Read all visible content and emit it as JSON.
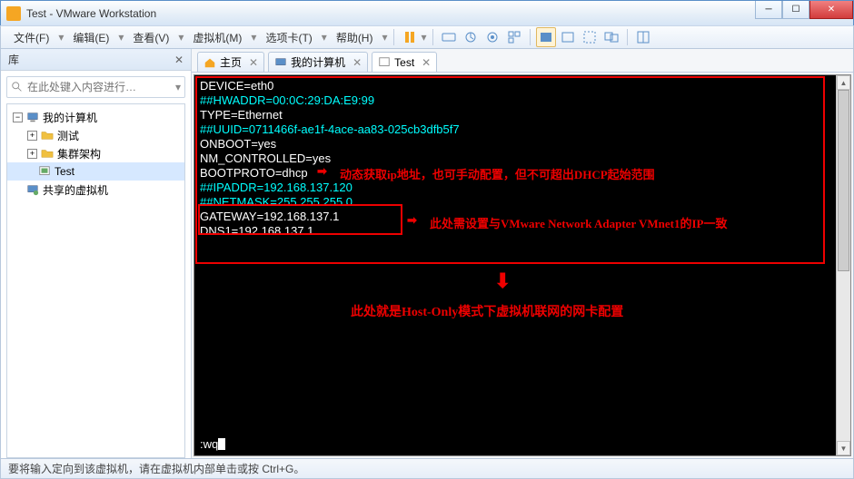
{
  "window": {
    "title": "Test - VMware Workstation"
  },
  "menus": {
    "file": "文件(F)",
    "edit": "编辑(E)",
    "view": "查看(V)",
    "vm": "虚拟机(M)",
    "tabs": "选项卡(T)",
    "help": "帮助(H)"
  },
  "sidebar": {
    "title": "库",
    "search_placeholder": "在此处键入内容进行…",
    "nodes": {
      "root": "我的计算机",
      "n1": "测试",
      "n2": "集群架构",
      "n3": "Test",
      "shared": "共享的虚拟机"
    }
  },
  "tabs": {
    "home": "主页",
    "mypc": "我的计算机",
    "test": "Test"
  },
  "terminal": {
    "lines": [
      {
        "cls": "c-white",
        "t": "DEVICE=eth0"
      },
      {
        "cls": "c-cyan",
        "t": "##HWADDR=00:0C:29:DA:E9:99"
      },
      {
        "cls": "c-white",
        "t": "TYPE=Ethernet"
      },
      {
        "cls": "c-cyan",
        "t": "##UUID=0711466f-ae1f-4ace-aa83-025cb3dfb5f7"
      },
      {
        "cls": "c-white",
        "t": "ONBOOT=yes"
      },
      {
        "cls": "c-white",
        "t": "NM_CONTROLLED=yes"
      },
      {
        "cls": "c-white",
        "t": "BOOTPROTO=dhcp"
      },
      {
        "cls": "c-cyan",
        "t": "##IPADDR=192.168.137.120"
      },
      {
        "cls": "c-cyan",
        "t": "##NETMASK=255.255.255.0"
      },
      {
        "cls": "c-white",
        "t": "GATEWAY=192.168.137.1"
      },
      {
        "cls": "c-white",
        "t": "DNS1=192.168.137.1"
      }
    ],
    "prompt": ":wq"
  },
  "annotations": {
    "a1": "动态获取ip地址，也可手动配置，但不可超出DHCP起始范围",
    "a2": "此处需设置与VMware Network Adapter VMnet1的IP一致",
    "a3": "此处就是Host-Only模式下虚拟机联网的网卡配置"
  },
  "statusbar": {
    "text": "要将输入定向到该虚拟机，请在虚拟机内部单击或按 Ctrl+G。"
  }
}
